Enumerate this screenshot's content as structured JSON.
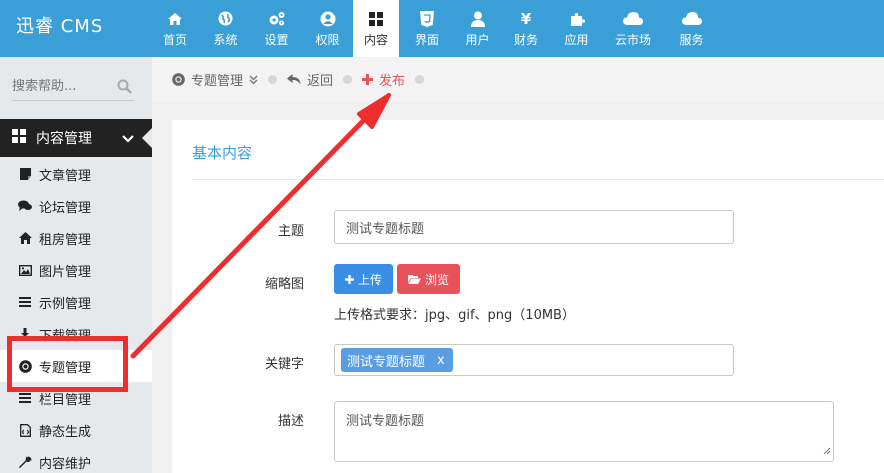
{
  "app": {
    "title": "迅睿 CMS"
  },
  "nav": {
    "items": [
      {
        "label": "首页",
        "icon": "home-icon"
      },
      {
        "label": "系统",
        "icon": "globe-icon"
      },
      {
        "label": "设置",
        "icon": "gears-icon"
      },
      {
        "label": "权限",
        "icon": "user-circle-icon"
      },
      {
        "label": "内容",
        "icon": "grid-icon",
        "active": true
      },
      {
        "label": "界面",
        "icon": "html5-icon"
      },
      {
        "label": "用户",
        "icon": "user-icon"
      },
      {
        "label": "财务",
        "icon": "yen-icon"
      },
      {
        "label": "应用",
        "icon": "puzzle-icon"
      },
      {
        "label": "云市场",
        "icon": "cloud-icon"
      },
      {
        "label": "服务",
        "icon": "cloud-icon"
      }
    ]
  },
  "sidebar": {
    "search_placeholder": "搜索帮助...",
    "section_title": "内容管理",
    "items": [
      {
        "label": "文章管理",
        "icon": "file-icon"
      },
      {
        "label": "论坛管理",
        "icon": "comments-icon"
      },
      {
        "label": "租房管理",
        "icon": "home-icon"
      },
      {
        "label": "图片管理",
        "icon": "image-icon"
      },
      {
        "label": "示例管理",
        "icon": "list-icon"
      },
      {
        "label": "下载管理",
        "icon": "download-icon"
      },
      {
        "label": "专题管理",
        "icon": "chrome-icon",
        "active": true
      },
      {
        "label": "栏目管理",
        "icon": "list-icon"
      },
      {
        "label": "静态生成",
        "icon": "html-file-icon"
      },
      {
        "label": "内容维护",
        "icon": "wrench-icon"
      }
    ]
  },
  "breadcrumb": {
    "current": "专题管理",
    "back": "返回",
    "publish": "发布"
  },
  "form": {
    "section_title": "基本内容",
    "subject_label": "主题",
    "subject_value": "测试专题标题",
    "thumb_label": "缩略图",
    "upload_button": "上传",
    "browse_button": "浏览",
    "upload_hint": "上传格式要求：jpg、gif、png（10MB）",
    "keywords_label": "关键字",
    "keyword_tag": "测试专题标题",
    "keyword_remove": "x",
    "desc_label": "描述",
    "desc_value": "测试专题标题"
  },
  "colors": {
    "topbar": "#3a9fd6",
    "annotation": "#ee2d2d",
    "primary_button": "#3a8ee6",
    "danger_button": "#e8535b"
  }
}
